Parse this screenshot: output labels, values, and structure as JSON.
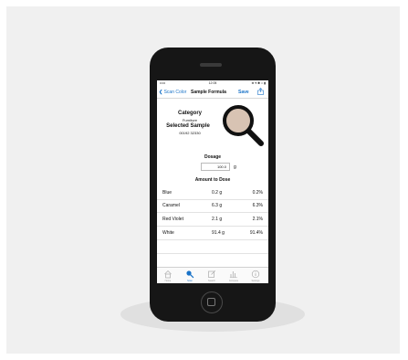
{
  "status_bar": {
    "signal": "•••••",
    "time": "12:05",
    "right": "⊕ ▾ ✱ ⌂ ▮"
  },
  "nav": {
    "back_label": "Scan Color",
    "title": "Sample Formula",
    "save_label": "Save"
  },
  "category": {
    "label": "Category",
    "value": "Furniture"
  },
  "selected_sample": {
    "label": "Selected Sample",
    "value": "00192 32330"
  },
  "swatch_color": "#d8c3b3",
  "dosage": {
    "label": "Dosage",
    "value": "100.0",
    "unit": "g"
  },
  "amount_to_dose": {
    "label": "Amount to Dose"
  },
  "ingredients": [
    {
      "name": "Blue",
      "amount": "0.2 g",
      "percent": "0.2%"
    },
    {
      "name": "Caramel",
      "amount": "6.3 g",
      "percent": "6.3%"
    },
    {
      "name": "Red Violet",
      "amount": "2.1 g",
      "percent": "2.1%"
    },
    {
      "name": "White",
      "amount": "91.4 g",
      "percent": "91.4%"
    }
  ],
  "tabs": [
    {
      "label": "Home",
      "icon": "home-icon",
      "active": false
    },
    {
      "label": "Scan",
      "icon": "search-icon",
      "active": true
    },
    {
      "label": "Search",
      "icon": "edit-icon",
      "active": false
    },
    {
      "label": "Compare",
      "icon": "chart-icon",
      "active": false
    },
    {
      "label": "Settings",
      "icon": "info-icon",
      "active": false
    }
  ],
  "colors": {
    "accent": "#1a73c8",
    "phone": "#161616",
    "background": "#f0f0f0"
  }
}
